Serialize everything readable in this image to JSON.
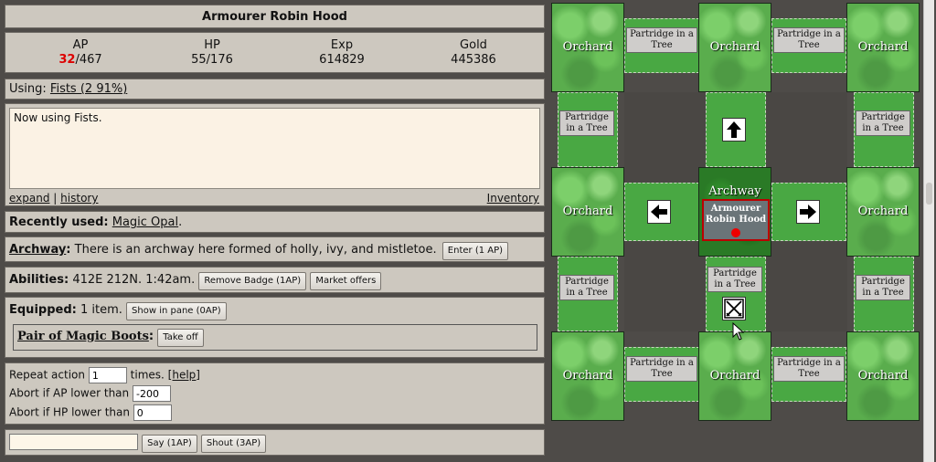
{
  "title": "Armourer Robin Hood",
  "stats": {
    "ap_label": "AP",
    "ap_current": "32",
    "ap_max": "/467",
    "hp_label": "HP",
    "hp_value": "55/176",
    "exp_label": "Exp",
    "exp_value": "614829",
    "gold_label": "Gold",
    "gold_value": "445386"
  },
  "using": {
    "label": "Using:",
    "weapon": "Fists (2 91%)"
  },
  "messages": {
    "text": "Now using Fists.",
    "expand": "expand",
    "sep": "|",
    "history": "history",
    "inventory": "Inventory"
  },
  "recent": {
    "label": "Recently used:",
    "item": "Magic Opal",
    "suffix": "."
  },
  "location": {
    "name": "Archway",
    "desc": "There is an archway here formed of holly, ivy, and mistletoe.",
    "enter_button": "Enter (1 AP)"
  },
  "abilities": {
    "label": "Abilities:",
    "text": "412E 212N. 1:42am.",
    "remove_badge": "Remove Badge (1AP)",
    "market": "Market offers"
  },
  "equipped": {
    "label": "Equipped:",
    "text": "1 item.",
    "show_button": "Show in pane (0AP)",
    "item_name": "Pair of Magic Boots",
    "item_suffix": ":",
    "take_off": "Take off"
  },
  "repeat": {
    "repeat_label": "Repeat action",
    "repeat_value": "1",
    "times_label": "times.",
    "help": "[help]",
    "ap_label": "Abort if AP lower than",
    "ap_value": "-200",
    "hp_label": "Abort if HP lower than",
    "hp_value": "0"
  },
  "say": {
    "input_value": "",
    "say_button": "Say (1AP)",
    "shout_button": "Shout (3AP)"
  },
  "map": {
    "orchard": "Orchard",
    "partridge": "Partridge in a Tree",
    "center_name": "Archway",
    "character": "Armourer Robin Hood",
    "tile_color": "#5aad4d",
    "center_color": "#2a7a26",
    "player_marker_color": "#e00000"
  }
}
